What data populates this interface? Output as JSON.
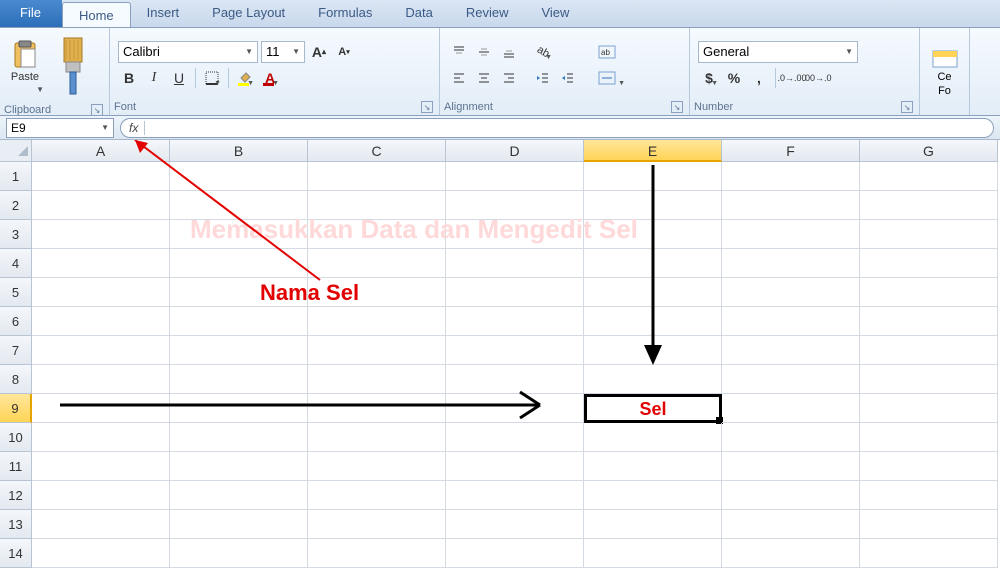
{
  "tabs": {
    "file": "File",
    "home": "Home",
    "insert": "Insert",
    "page_layout": "Page Layout",
    "formulas": "Formulas",
    "data": "Data",
    "review": "Review",
    "view": "View"
  },
  "ribbon": {
    "clipboard": {
      "title": "Clipboard",
      "paste": "Paste"
    },
    "font": {
      "title": "Font",
      "name": "Calibri",
      "size": "11",
      "bold": "B",
      "italic": "I",
      "underline": "U"
    },
    "alignment": {
      "title": "Alignment"
    },
    "number": {
      "title": "Number",
      "format": "General"
    },
    "cells_format": {
      "ce": "Ce",
      "fo": "Fo"
    }
  },
  "formula_bar": {
    "name_box": "E9",
    "fx": "fx",
    "value": ""
  },
  "grid": {
    "columns": [
      "A",
      "B",
      "C",
      "D",
      "E",
      "F",
      "G"
    ],
    "rows": [
      "1",
      "2",
      "3",
      "4",
      "5",
      "6",
      "7",
      "8",
      "9",
      "10",
      "11",
      "12",
      "13",
      "14"
    ],
    "active_col": "E",
    "active_row": "9",
    "active_cell_value": "Sel"
  },
  "annotations": {
    "nama_sel": "Nama Sel",
    "watermark": "Memasukkan Data dan Mengedit Sel"
  }
}
